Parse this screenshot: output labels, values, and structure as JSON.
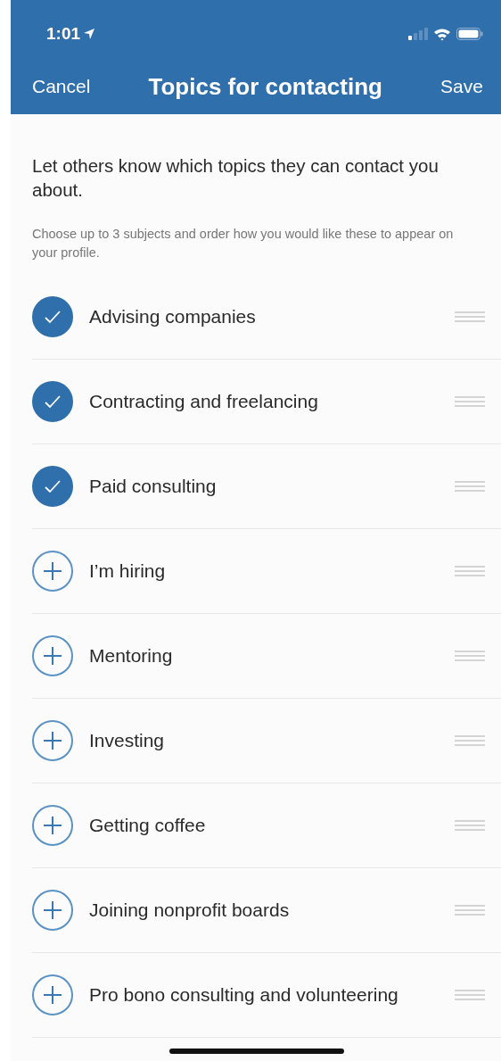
{
  "status_bar": {
    "time": "1:01"
  },
  "nav": {
    "cancel": "Cancel",
    "title": "Topics for contacting",
    "save": "Save"
  },
  "intro": "Let others know which topics they can contact you about.",
  "hint": "Choose up to 3 subjects and order how you would like these to appear on your profile.",
  "topics": [
    {
      "label": "Advising companies",
      "selected": true
    },
    {
      "label": "Contracting and freelancing",
      "selected": true
    },
    {
      "label": "Paid consulting",
      "selected": true
    },
    {
      "label": "I’m hiring",
      "selected": false
    },
    {
      "label": "Mentoring",
      "selected": false
    },
    {
      "label": "Investing",
      "selected": false
    },
    {
      "label": "Getting coffee",
      "selected": false
    },
    {
      "label": "Joining nonprofit boards",
      "selected": false
    },
    {
      "label": "Pro bono consulting and volunteering",
      "selected": false
    }
  ]
}
